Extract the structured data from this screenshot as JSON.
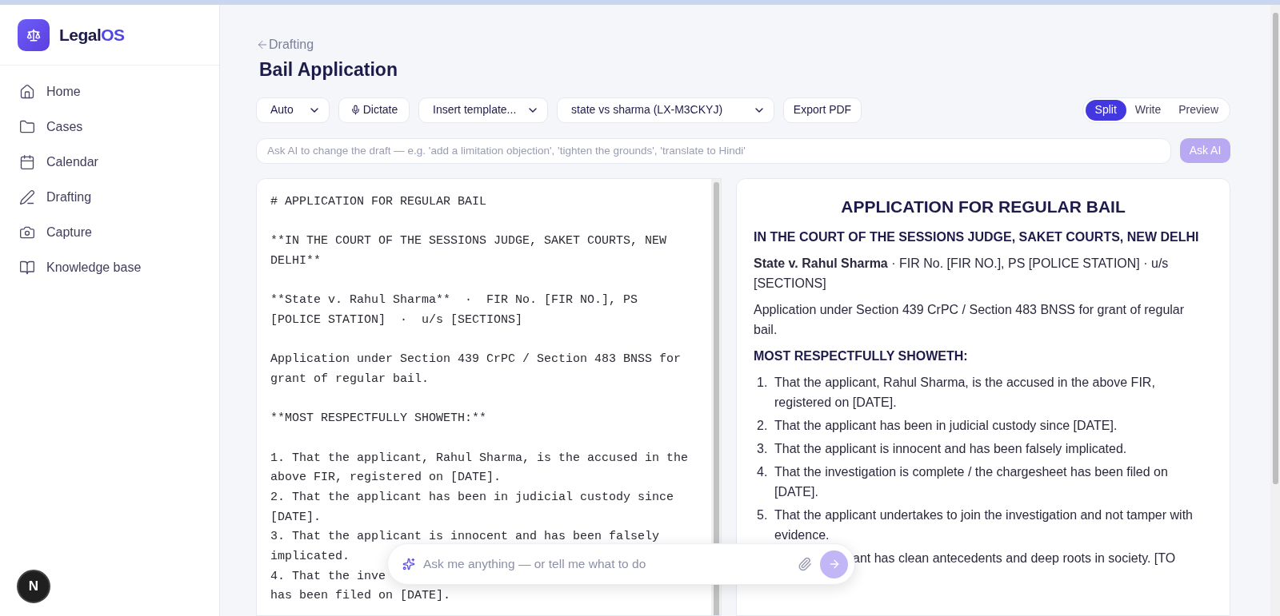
{
  "brand": {
    "name": "Legal",
    "accent": "OS"
  },
  "nav": [
    {
      "label": "Home"
    },
    {
      "label": "Cases"
    },
    {
      "label": "Calendar"
    },
    {
      "label": "Drafting"
    },
    {
      "label": "Capture"
    },
    {
      "label": "Knowledge base"
    }
  ],
  "badge": "N",
  "back_link": "Drafting",
  "title": "Bail Application",
  "toolbar": [
    {
      "kind": "select",
      "label": "Auto"
    },
    {
      "kind": "button",
      "label": "Dictate"
    },
    {
      "kind": "select",
      "label": "Insert template..."
    },
    {
      "kind": "select",
      "label": "state vs sharma (LX-M3CKYJ)"
    },
    {
      "kind": "button",
      "label": "Export PDF"
    }
  ],
  "view_tabs": [
    {
      "label": "Split",
      "selected": true
    },
    {
      "label": "Write",
      "selected": false
    },
    {
      "label": "Preview",
      "selected": false
    }
  ],
  "ask_ai": {
    "placeholder": "Ask AI to change the draft — e.g. 'add a limitation objection', 'tighten the grounds', 'translate to Hindi'",
    "button": "Ask AI",
    "disabled": true
  },
  "editor": {
    "blocks": [
      {
        "lines": [
          "# APPLICATION FOR REGULAR BAIL"
        ]
      },
      {
        "lines": [
          "**IN THE COURT OF THE SESSIONS JUDGE, SAKET COURTS, NEW",
          "DELHI**"
        ]
      },
      {
        "lines": [
          "**State v. Rahul Sharma**  ·  FIR No. [FIR NO.], PS",
          "[POLICE STATION]  ·  u/s [SECTIONS]"
        ]
      },
      {
        "lines": [
          "Application under Section 439 CrPC / Section 483 BNSS for",
          "grant of regular bail."
        ]
      },
      {
        "lines": [
          "**MOST RESPECTFULLY SHOWETH:**"
        ]
      },
      {
        "lines": [
          "1. That the applicant, Rahul Sharma, is the accused in the",
          "above FIR, registered on [DATE].",
          "2. That the applicant has been in judicial custody since",
          "[DATE].",
          "3. That the applicant is innocent and has been falsely",
          "implicated.",
          "4. That the inve",
          "has been filed on [DATE]."
        ]
      }
    ]
  },
  "preview": {
    "title": "APPLICATION FOR REGULAR BAIL",
    "blocks": [
      {
        "kind": "heading",
        "text": "IN THE COURT OF THE SESSIONS JUDGE, SAKET COURTS, NEW DELHI"
      },
      {
        "kind": "para",
        "text": "**State v. Rahul Sharma** · FIR No. [FIR NO.], PS [POLICE STATION] · u/s [SECTIONS]"
      },
      {
        "kind": "para",
        "text": "Application under Section 439 CrPC / Section 483 BNSS for grant of regular bail."
      },
      {
        "kind": "heading",
        "text": "MOST RESPECTFULLY SHOWETH:"
      },
      {
        "kind": "list",
        "items": [
          {
            "kind": "item",
            "number": "1.",
            "text": "That the applicant, Rahul Sharma, is the accused in the above FIR, registered on [DATE]."
          },
          {
            "kind": "item",
            "number": "2.",
            "text": "That the applicant has been in judicial custody since [DATE]."
          },
          {
            "kind": "item",
            "number": "3.",
            "text": "That the applicant is innocent and has been falsely implicated."
          },
          {
            "kind": "item",
            "number": "4.",
            "text": "That the investigation is complete / the chargesheet has been filed on [DATE]."
          },
          {
            "kind": "item",
            "number": "5.",
            "text": "That the applicant undertakes to join the investigation and not tamper with evidence."
          },
          {
            "kind": "cut",
            "text": "ant has clean antecedents and deep roots in society. [TO"
          }
        ]
      }
    ]
  },
  "chat": {
    "placeholder": "Ask me anything — or tell me what to do"
  }
}
